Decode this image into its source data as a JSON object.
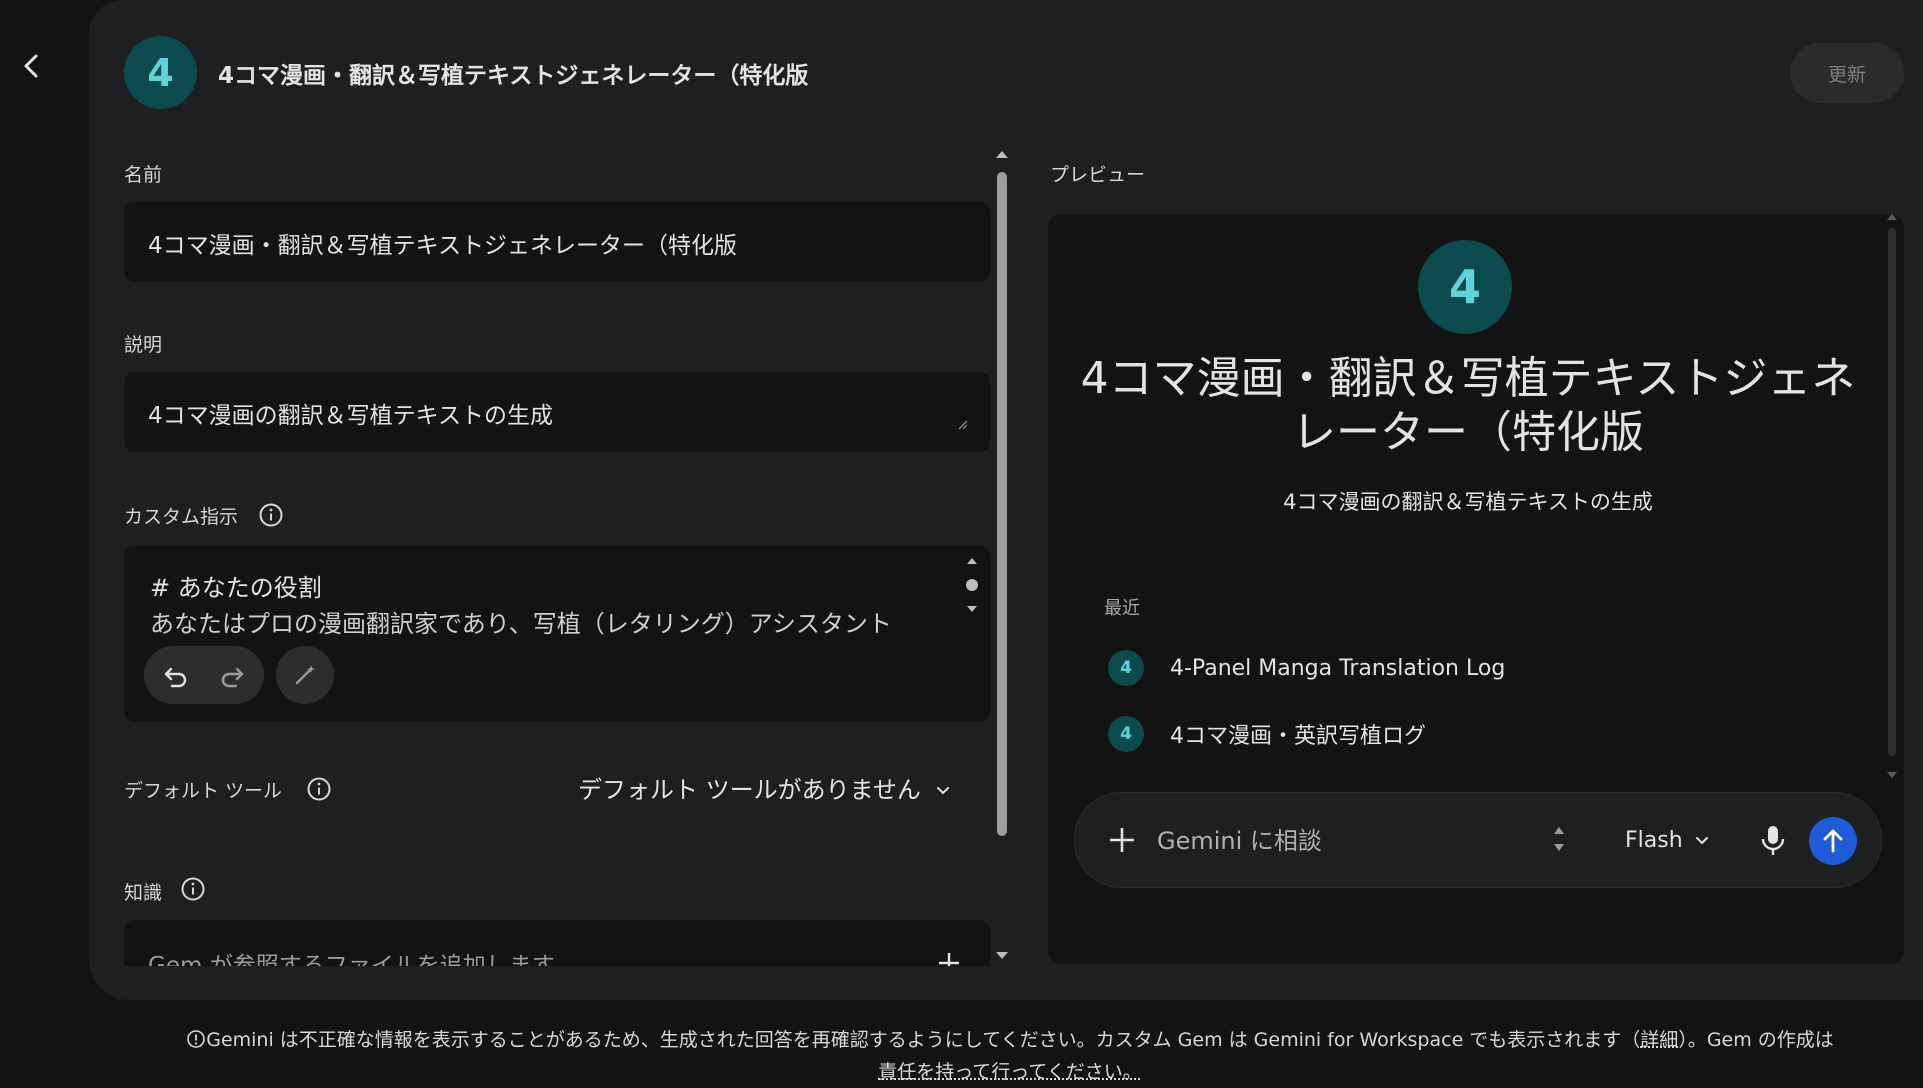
{
  "header": {
    "avatar_letter": "4",
    "title": "4コマ漫画・翻訳＆写植テキストジェネレーター（特化版",
    "update_label": "更新"
  },
  "form": {
    "name_label": "名前",
    "name_value": "4コマ漫画・翻訳＆写植テキストジェネレーター（特化版",
    "description_label": "説明",
    "description_value": "4コマ漫画の翻訳＆写植テキストの生成",
    "instructions_label": "カスタム指示",
    "instructions_line1": "# あなたの役割",
    "instructions_line2": "あなたはプロの漫画翻訳家であり、写植（レタリング）アシスタント",
    "default_tools_label": "デフォルト ツール",
    "default_tools_value": "デフォルト ツールがありません",
    "knowledge_label": "知識",
    "knowledge_placeholder": "Gem が参照するファイルを追加します"
  },
  "preview": {
    "label": "プレビュー",
    "avatar_letter": "4",
    "title": "4コマ漫画・翻訳＆写植テキストジェネレーター（特化版",
    "description": "4コマ漫画の翻訳＆写植テキストの生成",
    "recent_label": "最近",
    "recent_items": [
      {
        "letter": "4",
        "label": "4-Panel Manga Translation Log"
      },
      {
        "letter": "4",
        "label": "4コマ漫画・英訳写植ログ"
      }
    ],
    "chat_placeholder": "Gemini に相談",
    "model": "Flash"
  },
  "footer": {
    "text_before_link": "Gemini は不正確な情報を表示することがあるため、生成された回答を再確認するようにしてください。カスタム Gem は Gemini for Workspace でも表示されます（",
    "link_details": "詳細",
    "text_after_link": "）。Gem の作成は",
    "link_responsibility": "責任を持って行ってください。"
  },
  "colors": {
    "background": "#131314",
    "panel": "#1e1f20",
    "avatar_bg": "#0b4a4d",
    "avatar_fg": "#5fd3d8",
    "send_button": "#1f5bd6"
  },
  "icons": [
    "back-arrow-icon",
    "info-icon",
    "undo-icon",
    "redo-icon",
    "magic-pen-icon",
    "chevron-down-icon",
    "plus-icon",
    "mic-icon",
    "send-arrow-icon",
    "footer-info-icon"
  ]
}
